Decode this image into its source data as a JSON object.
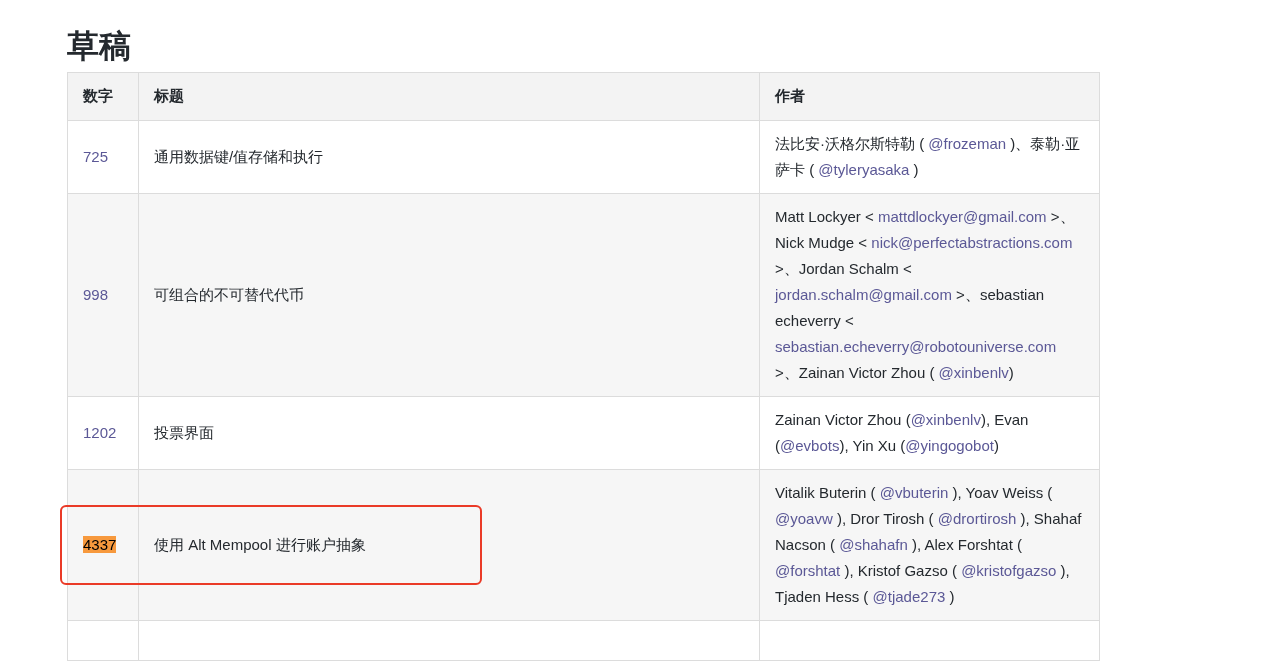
{
  "heading": "草稿",
  "table": {
    "columns": [
      "数字",
      "标题",
      "作者"
    ],
    "rows": [
      {
        "number": "725",
        "title": "通用数据键/值存储和执行",
        "highlighted": false,
        "circled": false,
        "authors": [
          {
            "kind": "text",
            "text": "法比安·沃格尔斯特勒 ( "
          },
          {
            "kind": "link",
            "text": "@frozeman"
          },
          {
            "kind": "text",
            "text": " )、泰勒·亚萨卡 ( "
          },
          {
            "kind": "link",
            "text": "@tyleryasaka"
          },
          {
            "kind": "text",
            "text": " )"
          }
        ]
      },
      {
        "number": "998",
        "title": "可组合的不可替代代币",
        "highlighted": false,
        "circled": false,
        "authors": [
          {
            "kind": "text",
            "text": "Matt Lockyer < "
          },
          {
            "kind": "link",
            "text": "mattdlockyer@gmail.com"
          },
          {
            "kind": "text",
            "text": " >、Nick Mudge < "
          },
          {
            "kind": "link",
            "text": "nick@perfectabstractions.com"
          },
          {
            "kind": "text",
            "text": " >、Jordan Schalm < "
          },
          {
            "kind": "link",
            "text": "jordan.schalm@gmail.com"
          },
          {
            "kind": "text",
            "text": " >、sebastian echeverry < "
          },
          {
            "kind": "link",
            "text": "sebastian.echeverry@robotouniverse.com"
          },
          {
            "kind": "text",
            "text": " >、Zainan Victor Zhou ( "
          },
          {
            "kind": "link",
            "text": "@xinbenlv"
          },
          {
            "kind": "text",
            "text": ")"
          }
        ]
      },
      {
        "number": "1202",
        "title": "投票界面",
        "highlighted": false,
        "circled": false,
        "authors": [
          {
            "kind": "text",
            "text": "Zainan Victor Zhou ("
          },
          {
            "kind": "link",
            "text": "@xinbenlv"
          },
          {
            "kind": "text",
            "text": "), Evan ("
          },
          {
            "kind": "link",
            "text": "@evbots"
          },
          {
            "kind": "text",
            "text": "), Yin Xu ("
          },
          {
            "kind": "link",
            "text": "@yingogobot"
          },
          {
            "kind": "text",
            "text": ")"
          }
        ]
      },
      {
        "number": "4337",
        "title": "使用 Alt Mempool 进行账户抽象",
        "highlighted": true,
        "circled": true,
        "authors": [
          {
            "kind": "text",
            "text": "Vitalik Buterin ( "
          },
          {
            "kind": "link",
            "text": "@vbuterin"
          },
          {
            "kind": "text",
            "text": " ), Yoav Weiss ( "
          },
          {
            "kind": "link",
            "text": "@yoavw"
          },
          {
            "kind": "text",
            "text": " ), Dror Tirosh ( "
          },
          {
            "kind": "link",
            "text": "@drortirosh"
          },
          {
            "kind": "text",
            "text": " ), Shahaf Nacson ( "
          },
          {
            "kind": "link",
            "text": "@shahafn"
          },
          {
            "kind": "text",
            "text": " ), Alex Forshtat ( "
          },
          {
            "kind": "link",
            "text": "@forshtat"
          },
          {
            "kind": "text",
            "text": " ), Kristof Gazso ( "
          },
          {
            "kind": "link",
            "text": "@kristofgazso"
          },
          {
            "kind": "text",
            "text": " ), Tjaden Hess ( "
          },
          {
            "kind": "link",
            "text": "@tjade273"
          },
          {
            "kind": "text",
            "text": " )"
          }
        ]
      }
    ]
  }
}
